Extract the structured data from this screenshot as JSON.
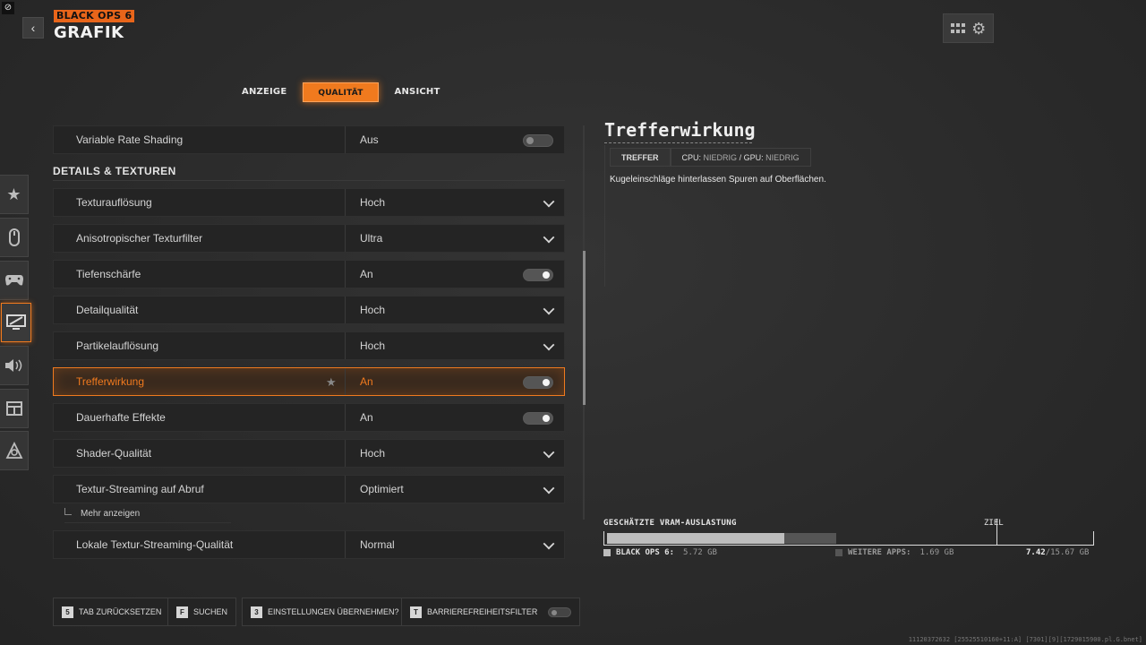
{
  "header": {
    "brand": "BLACK OPS 6",
    "title": "GRAFIK"
  },
  "tabs": [
    {
      "label": "ANZEIGE",
      "active": false
    },
    {
      "label": "QUALITÄT",
      "active": true
    },
    {
      "label": "ANSICHT",
      "active": false
    }
  ],
  "sidenav": [
    "star-icon",
    "mouse-icon",
    "controller-icon",
    "monitor-icon",
    "speaker-icon",
    "interface-icon",
    "network-icon"
  ],
  "rows_top": {
    "variable_rate_shading": {
      "label": "Variable Rate Shading",
      "value": "Aus",
      "control": "toggle",
      "on": false
    }
  },
  "section": {
    "title": "DETAILS & TEXTUREN"
  },
  "rows": [
    {
      "label": "Texturauflösung",
      "value": "Hoch",
      "control": "dropdown"
    },
    {
      "label": "Anisotropischer Texturfilter",
      "value": "Ultra",
      "control": "dropdown"
    },
    {
      "label": "Tiefenschärfe",
      "value": "An",
      "control": "toggle",
      "on": true
    },
    {
      "label": "Detailqualität",
      "value": "Hoch",
      "control": "dropdown"
    },
    {
      "label": "Partikelauflösung",
      "value": "Hoch",
      "control": "dropdown"
    },
    {
      "label": "Trefferwirkung",
      "value": "An",
      "control": "toggle",
      "on": true,
      "selected": true
    },
    {
      "label": "Dauerhafte Effekte",
      "value": "An",
      "control": "toggle",
      "on": true
    },
    {
      "label": "Shader-Qualität",
      "value": "Hoch",
      "control": "dropdown"
    },
    {
      "label": "Textur-Streaming auf Abruf",
      "value": "Optimiert",
      "control": "dropdown"
    }
  ],
  "more_label": "Mehr anzeigen",
  "rows_bottom": {
    "local_streaming": {
      "label": "Lokale Textur-Streaming-Qualität",
      "value": "Normal",
      "control": "dropdown"
    }
  },
  "detail": {
    "title": "Trefferwirkung",
    "tag_primary": "TREFFER",
    "cpu_label": "CPU:",
    "cpu_value": "NIEDRIG",
    "sep": "/",
    "gpu_label": "GPU:",
    "gpu_value": "NIEDRIG",
    "description": "Kugeleinschläge hinterlassen Spuren auf Oberflächen."
  },
  "vram": {
    "title": "GESCHÄTZTE VRAM-AUSLASTUNG",
    "target_label": "ZIEL",
    "total_gb": 15.67,
    "game": {
      "label": "BLACK OPS 6:",
      "value": "5.72 GB",
      "gb": 5.72,
      "color": "#bdbdbd"
    },
    "other": {
      "label": "WEITERE APPS:",
      "value": "1.69 GB",
      "gb": 1.69,
      "color": "#555555"
    },
    "target_fraction": 0.8,
    "used": "7.42",
    "total": "/15.67 GB"
  },
  "bottom_buttons": [
    {
      "key": "5",
      "label": "TAB ZURÜCKSETZEN"
    },
    {
      "key": "F",
      "label": "SUCHEN"
    },
    {
      "key": "3",
      "label": "EINSTELLUNGEN ÜBERNEHMEN?"
    },
    {
      "key": "T",
      "label": "BARRIEREFREIHEITSFILTER"
    }
  ],
  "footer_code": "11120372632 [25525510160+11:A] [7301][9][1729015900.pl.G.bnet]",
  "colors": {
    "accent": "#f07a1e",
    "background": "#2c2c2c",
    "row": "#242424"
  }
}
